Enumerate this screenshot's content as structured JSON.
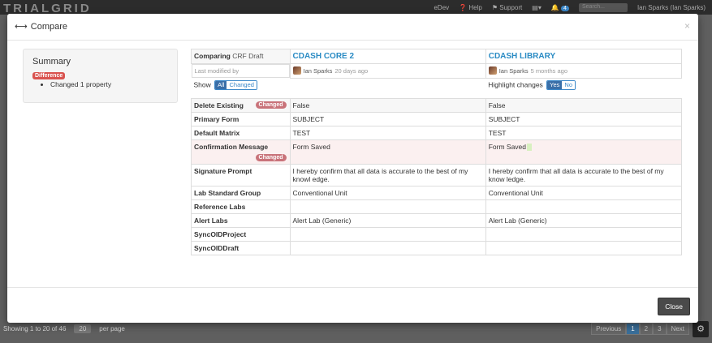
{
  "app": {
    "brand": "TRIALGRID",
    "nav": {
      "env": "eDev",
      "help": "Help",
      "support": "Support",
      "notif_count": "4",
      "search_placeholder": "Search...",
      "user": "Ian Sparks (Ian Sparks)"
    }
  },
  "background": {
    "showing": "Showing 1 to 20 of 46",
    "per_page_value": "20",
    "per_page_label": "per page",
    "pager": [
      "Previous",
      "1",
      "2",
      "3",
      "Next"
    ]
  },
  "modal": {
    "title": "Compare",
    "close_x": "×",
    "close_button": "Close",
    "summary": {
      "title": "Summary",
      "difference_label": "Difference",
      "items": [
        "Changed 1 property"
      ]
    },
    "header": {
      "comparing_label": "Comparing",
      "comparing_type": "CRF Draft",
      "left_title": "CDASH CORE 2",
      "right_title": "CDASH LIBRARY",
      "last_modified_label": "Last modified by",
      "left_user": "Ian Sparks",
      "left_time": "20 days ago",
      "right_user": "Ian Sparks",
      "right_time": "5 months ago",
      "show_label": "Show",
      "show_all": "All",
      "show_changed": "Changed",
      "highlight_label": "Highlight changes",
      "highlight_yes": "Yes",
      "highlight_no": "No"
    },
    "changed_badge": "Changed",
    "rows": [
      {
        "name": "Delete Existing",
        "left": "False",
        "right": "False"
      },
      {
        "name": "Primary Form",
        "left": "SUBJECT",
        "right": "SUBJECT"
      },
      {
        "name": "Default Matrix",
        "left": "TEST",
        "right": "TEST"
      },
      {
        "name": "Confirmation Message",
        "left": "Form Saved",
        "right": "Form Saved"
      },
      {
        "name": "Signature Prompt",
        "left": "I hereby confirm that all data is accurate to the best of my knowl edge.",
        "right": "I hereby confirm that all data is accurate to the best of my know ledge."
      },
      {
        "name": "Lab Standard Group",
        "left": "Conventional Unit",
        "right": "Conventional Unit"
      },
      {
        "name": "Reference Labs",
        "left": "",
        "right": ""
      },
      {
        "name": "Alert Labs",
        "left": "Alert Lab (Generic)",
        "right": "Alert Lab (Generic)"
      },
      {
        "name": "SyncOIDProject",
        "left": "",
        "right": ""
      },
      {
        "name": "SyncOIDDraft",
        "left": "",
        "right": ""
      }
    ]
  },
  "colors": {
    "accent": "#2a8bc4",
    "changed": "#c9737a",
    "difference": "#d9534f"
  }
}
